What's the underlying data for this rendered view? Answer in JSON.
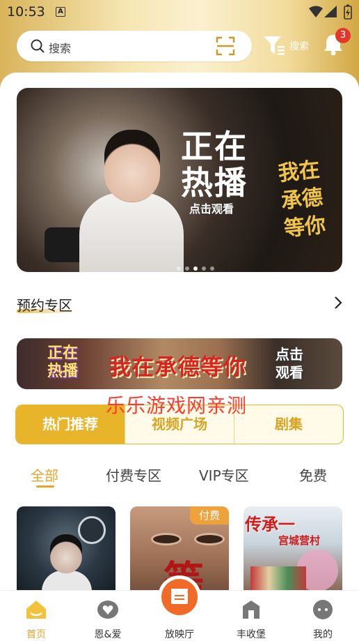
{
  "status_bar": {
    "time": "10:53",
    "notif_icon": "A"
  },
  "search": {
    "placeholder": "搜索",
    "filter_label": "搜索",
    "notification_count": "3"
  },
  "banner": {
    "title_line1": "正在",
    "title_line2": "热播",
    "subtitle": "点击观看",
    "calligraphy": "我在承德等你",
    "slides_total": 5,
    "slide_active": 3
  },
  "reservation": {
    "title": "预约专区"
  },
  "promo": {
    "left_line1": "正在",
    "left_line2": "热播",
    "center": "我在承德等你",
    "right_line1": "点击",
    "right_line2": "观看"
  },
  "watermark": "乐乐游戏网亲测",
  "main_tabs": [
    "热门推荐",
    "视频广场",
    "剧集"
  ],
  "main_tab_active": 0,
  "sub_tabs": [
    "全部",
    "付费专区",
    "VIP专区",
    "免费"
  ],
  "sub_tab_active": 0,
  "thumbnails": [
    {
      "badge": ""
    },
    {
      "badge": "付费",
      "calligraphy": "等"
    },
    {
      "calligraphy": "传承一",
      "subtitle": "宫城营村"
    }
  ],
  "bottom_nav": [
    {
      "label": "首页",
      "icon": "home-icon"
    },
    {
      "label": "恩&爱",
      "icon": "heart-icon"
    },
    {
      "label": "放映厅",
      "icon": "clapper-icon"
    },
    {
      "label": "丰收堡",
      "icon": "house-icon"
    },
    {
      "label": "我的",
      "icon": "profile-icon"
    }
  ],
  "colors": {
    "accent": "#E8B42A",
    "badge": "#E2382B",
    "center_button": "#F06A28"
  }
}
